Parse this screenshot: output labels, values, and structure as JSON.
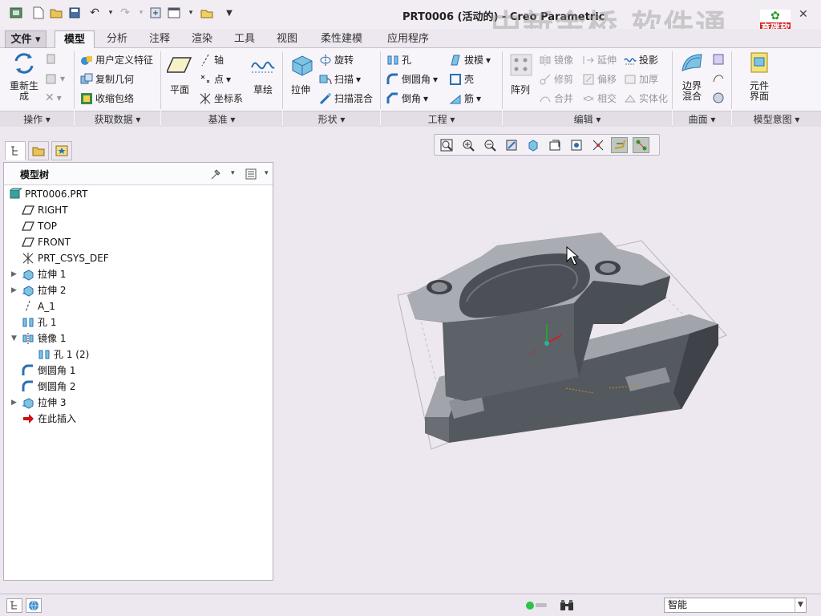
{
  "window": {
    "title": "PRT0006 (活动的) - Creo Parametric",
    "watermark_text": "中新金桥 软件通",
    "watermark_logo": "育碟软件",
    "close_glyph": "✕"
  },
  "tabs": [
    {
      "label": "文件 ▾"
    },
    {
      "label": "模型",
      "active": true
    },
    {
      "label": "分析"
    },
    {
      "label": "注释"
    },
    {
      "label": "渲染"
    },
    {
      "label": "工具"
    },
    {
      "label": "视图"
    },
    {
      "label": "柔性建模"
    },
    {
      "label": "应用程序"
    }
  ],
  "ribbon": {
    "regenerate_label": "重新生\n成",
    "get_data": {
      "udf": "用户定义特征",
      "copy_geom": "复制几何",
      "shrinkwrap": "收缩包络"
    },
    "datum": {
      "plane": "平面",
      "axis": "轴",
      "point": "点",
      "csys": "坐标系",
      "sketch": "草绘"
    },
    "shapes": {
      "extrude": "拉伸",
      "revolve": "旋转",
      "sweep": "扫描",
      "swept_blend": "扫描混合"
    },
    "engineering": {
      "hole": "孔",
      "round": "倒圆角",
      "chamfer": "倒角",
      "draft": "拔模",
      "shell": "壳",
      "rib": "筋"
    },
    "editing": {
      "pattern": "阵列",
      "mirror": "镜像",
      "trim": "修剪",
      "merge": "合并",
      "extend": "延伸",
      "offset": "偏移",
      "intersect": "相交",
      "project": "投影",
      "thicken": "加厚",
      "solidify": "实体化"
    },
    "surfaces": {
      "boundary_blend": "边界\n混合"
    },
    "intent": {
      "component_interface": "元件\n界面"
    },
    "groups": [
      "操作 ▾",
      "获取数据 ▾",
      "基准 ▾",
      "形状 ▾",
      "工程 ▾",
      "编辑 ▾",
      "曲面 ▾",
      "模型意图 ▾"
    ]
  },
  "model_tree": {
    "title": "模型树",
    "items": [
      {
        "label": "PRT0006.PRT",
        "icon": "part-icon",
        "level": 0
      },
      {
        "label": "RIGHT",
        "icon": "datum-plane-icon",
        "level": 1
      },
      {
        "label": "TOP",
        "icon": "datum-plane-icon",
        "level": 1
      },
      {
        "label": "FRONT",
        "icon": "datum-plane-icon",
        "level": 1
      },
      {
        "label": "PRT_CSYS_DEF",
        "icon": "csys-icon",
        "level": 1
      },
      {
        "label": "拉伸 1",
        "icon": "extrude-icon",
        "level": 1,
        "expander": "▶"
      },
      {
        "label": "拉伸 2",
        "icon": "extrude-icon",
        "level": 1,
        "expander": "▶"
      },
      {
        "label": "A_1",
        "icon": "datum-axis-icon",
        "level": 1
      },
      {
        "label": "孔 1",
        "icon": "hole-icon",
        "level": 1
      },
      {
        "label": "镜像 1",
        "icon": "mirror-icon",
        "level": 1,
        "expander": "▼"
      },
      {
        "label": "孔 1 (2)",
        "icon": "hole-icon",
        "level": 2
      },
      {
        "label": "倒圆角 1",
        "icon": "round-icon",
        "level": 1
      },
      {
        "label": "倒圆角 2",
        "icon": "round-icon",
        "level": 1
      },
      {
        "label": "拉伸 3",
        "icon": "extrude-icon",
        "level": 1,
        "expander": "▶"
      },
      {
        "label": "在此插入",
        "icon": "insert-arrow-icon",
        "level": 1
      }
    ]
  },
  "statusbar": {
    "filter_value": "智能"
  },
  "colors": {
    "accent": "#3aa0c8",
    "model_dark": "#5a5e66",
    "model_light": "#9a9ea6",
    "insert_arrow": "#cc1111"
  }
}
